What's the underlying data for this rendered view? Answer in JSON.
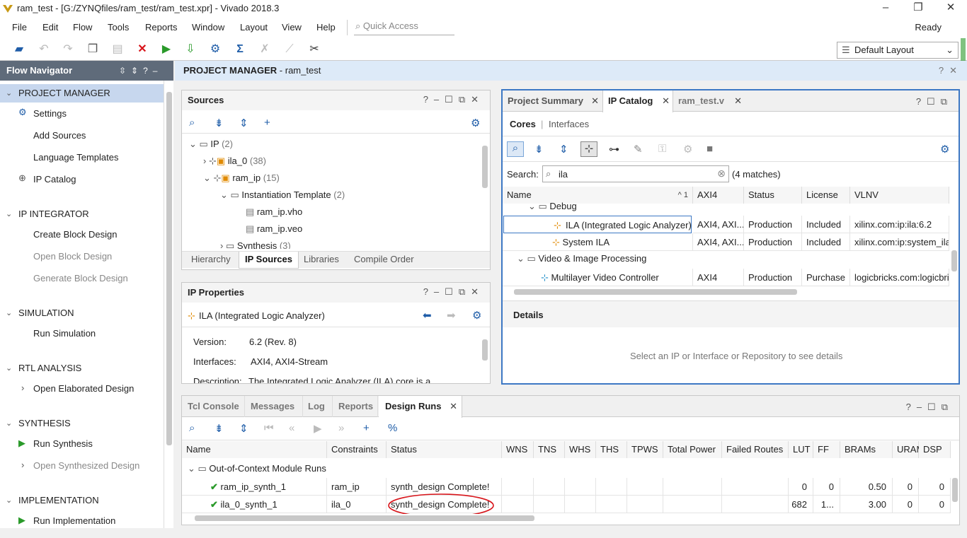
{
  "window": {
    "title": "ram_test - [G:/ZYNQfiles/ram_test/ram_test.xpr] - Vivado 2018.3"
  },
  "menu": [
    "File",
    "Edit",
    "Flow",
    "Tools",
    "Reports",
    "Window",
    "Layout",
    "View",
    "Help"
  ],
  "quick_access": {
    "placeholder": "Quick Access"
  },
  "status": "Ready",
  "layout_select": {
    "value": "Default Layout"
  },
  "flow_navigator": {
    "title": "Flow Navigator",
    "sections": {
      "project_manager": {
        "label": "PROJECT MANAGER",
        "items": [
          "Settings",
          "Add Sources",
          "Language Templates",
          "IP Catalog"
        ]
      },
      "ip_integrator": {
        "label": "IP INTEGRATOR",
        "items": [
          "Create Block Design",
          "Open Block Design",
          "Generate Block Design"
        ]
      },
      "simulation": {
        "label": "SIMULATION",
        "items": [
          "Run Simulation"
        ]
      },
      "rtl_analysis": {
        "label": "RTL ANALYSIS",
        "items": [
          "Open Elaborated Design"
        ]
      },
      "synthesis": {
        "label": "SYNTHESIS",
        "items": [
          "Run Synthesis",
          "Open Synthesized Design"
        ]
      },
      "implementation": {
        "label": "IMPLEMENTATION",
        "items": [
          "Run Implementation"
        ]
      }
    }
  },
  "pm_header": {
    "title": "PROJECT MANAGER",
    "project": " - ram_test"
  },
  "sources": {
    "title": "Sources",
    "tree": {
      "ip": "IP",
      "ip_count": "(2)",
      "ila": "ila_0",
      "ila_count": "(38)",
      "ram": "ram_ip",
      "ram_count": "(15)",
      "inst": "Instantiation Template",
      "inst_count": "(2)",
      "vho": "ram_ip.vho",
      "veo": "ram_ip.veo",
      "syn": "Synthesis",
      "syn_count": "(3)"
    },
    "tabs": [
      "Hierarchy",
      "IP Sources",
      "Libraries",
      "Compile Order"
    ]
  },
  "ip_properties": {
    "title": "IP Properties",
    "name": "ILA (Integrated Logic Analyzer)",
    "version_label": "Version:",
    "version": "6.2 (Rev. 8)",
    "interfaces_label": "Interfaces:",
    "interfaces": "AXI4, AXI4-Stream",
    "description_label": "Description:",
    "description": "The Integrated Logic Analyzer (ILA) core is a"
  },
  "ip_catalog": {
    "tabs": [
      "Project Summary",
      "IP Catalog",
      "ram_test.v"
    ],
    "subtabs": {
      "cores": "Cores",
      "interfaces": "Interfaces"
    },
    "search_label": "Search:",
    "search_value": "ila",
    "matches": "(4 matches)",
    "columns": [
      "Name",
      "AXI4",
      "Status",
      "License",
      "VLNV"
    ],
    "sort_indicator": "^ 1",
    "group_debug": "Debug",
    "rows_debug": [
      {
        "name": "ILA (Integrated Logic Analyzer)",
        "axi4": "AXI4, AXI...",
        "status": "Production",
        "license": "Included",
        "vlnv": "xilinx.com:ip:ila:6.2"
      },
      {
        "name": "System ILA",
        "axi4": "AXI4, AXI...",
        "status": "Production",
        "license": "Included",
        "vlnv": "xilinx.com:ip:system_ila:"
      }
    ],
    "group_video": "Video & Image Processing",
    "rows_video": [
      {
        "name": "Multilayer Video Controller",
        "axi4": "AXI4",
        "status": "Production",
        "license": "Purchase",
        "vlnv": "logicbricks.com:logicbri"
      }
    ],
    "details_title": "Details",
    "details_hint": "Select an IP or Interface or Repository to see details"
  },
  "bottom": {
    "tabs": [
      "Tcl Console",
      "Messages",
      "Log",
      "Reports",
      "Design Runs"
    ],
    "columns": [
      "Name",
      "Constraints",
      "Status",
      "WNS",
      "TNS",
      "WHS",
      "THS",
      "TPWS",
      "Total Power",
      "Failed Routes",
      "LUT",
      "FF",
      "BRAMs",
      "URAM",
      "DSP"
    ],
    "group": "Out-of-Context Module Runs",
    "runs": [
      {
        "name": "ram_ip_synth_1",
        "constraints": "ram_ip",
        "status": "synth_design Complete!",
        "lut": "0",
        "ff": "0",
        "brams": "0.50",
        "uram": "0",
        "dsp": "0"
      },
      {
        "name": "ila_0_synth_1",
        "constraints": "ila_0",
        "status": "synth_design Complete!",
        "lut": "682",
        "ff": "1...",
        "brams": "3.00",
        "uram": "0",
        "dsp": "0"
      }
    ]
  },
  "colors": {
    "accent": "#1f5da8",
    "nav_header": "#5f6b7a",
    "selected": "#c7d7ee",
    "annotation": "#d8141a",
    "green": "#2a9a2a"
  }
}
